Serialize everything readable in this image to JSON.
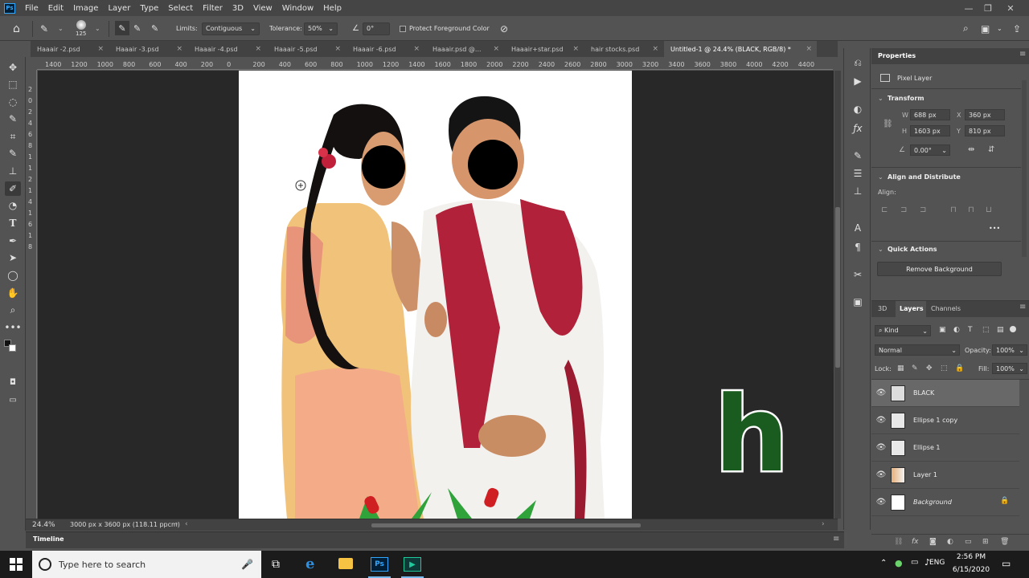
{
  "app": {
    "logo": "Ps"
  },
  "menu": [
    "File",
    "Edit",
    "Image",
    "Layer",
    "Type",
    "Select",
    "Filter",
    "3D",
    "View",
    "Window",
    "Help"
  ],
  "window_controls": {
    "minimize": "—",
    "restore": "❐",
    "close": "✕"
  },
  "options_bar": {
    "brush_size": "125",
    "limits_label": "Limits:",
    "limits_value": "Contiguous",
    "tolerance_label": "Tolerance:",
    "tolerance_value": "50%",
    "angle_value": "0°",
    "protect_label": "Protect Foreground Color"
  },
  "tabs": [
    "Haaair -2.psd",
    "Haaair -3.psd",
    "Haaair -4.psd",
    "Haaair -5.psd",
    "Haaair -6.psd",
    "Haaair.psd @...",
    "Haaair+star.psd",
    "hair stocks.psd",
    "Untitled-1 @ 24.4% (BLACK, RGB/8) *"
  ],
  "tab_close": "×",
  "ruler_h": [
    "1400",
    "1200",
    "1000",
    "800",
    "600",
    "400",
    "200",
    "0",
    "200",
    "400",
    "600",
    "800",
    "1000",
    "1200",
    "1400",
    "1600",
    "1800",
    "2000",
    "2200",
    "2400",
    "2600",
    "2800",
    "3000",
    "3200",
    "3400",
    "3600",
    "3800",
    "4000",
    "4200",
    "4400"
  ],
  "ruler_v": [
    "2",
    "0",
    "2",
    "4",
    "6",
    "8",
    "1",
    "1",
    "2",
    "1",
    "4",
    "1",
    "6",
    "1",
    "8"
  ],
  "status": {
    "zoom": "24.4%",
    "doc_info": "3000 px x 3600 px (118.11 ppcm)"
  },
  "overlay_letter": "h",
  "properties": {
    "title": "Properties",
    "kind": "Pixel Layer",
    "transform_title": "Transform",
    "w_label": "W",
    "w_value": "688 px",
    "h_label": "H",
    "h_value": "1603 px",
    "x_label": "X",
    "x_value": "360 px",
    "y_label": "Y",
    "y_value": "810 px",
    "angle_value": "0.00°",
    "align_title": "Align and Distribute",
    "align_label": "Align:",
    "more": "•••",
    "quick_actions_title": "Quick Actions",
    "remove_bg": "Remove Background"
  },
  "layers_panel": {
    "tabs": [
      "3D",
      "Layers",
      "Channels"
    ],
    "kind_filter": "Kind",
    "blend_mode": "Normal",
    "opacity_label": "Opacity:",
    "opacity_value": "100%",
    "lock_label": "Lock:",
    "fill_label": "Fill:",
    "fill_value": "100%",
    "layers": [
      {
        "name": "BLACK",
        "selected": true
      },
      {
        "name": "Ellipse 1 copy",
        "selected": false
      },
      {
        "name": "Ellipse 1",
        "selected": false
      },
      {
        "name": "Layer 1",
        "selected": false
      },
      {
        "name": "Background",
        "selected": false,
        "locked": true
      }
    ]
  },
  "timeline": {
    "label": "Timeline"
  },
  "taskbar": {
    "search_placeholder": "Type here to search",
    "tray_lang": "ENG",
    "time": "2:56 PM",
    "date": "6/15/2020"
  }
}
